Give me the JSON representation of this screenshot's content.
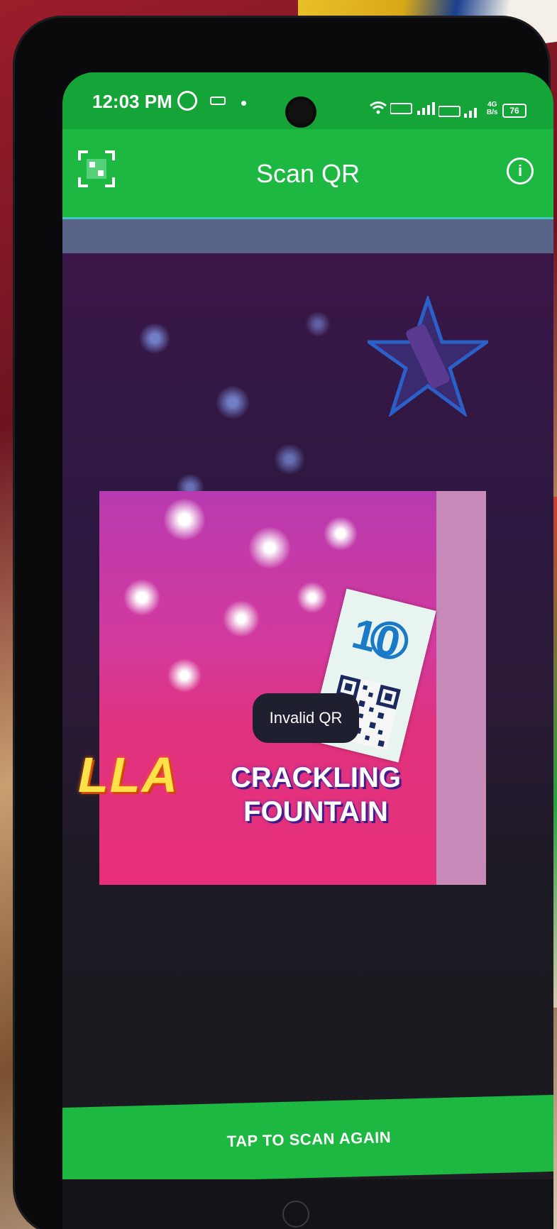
{
  "status_bar": {
    "time": "12:03 PM",
    "speed_top": "4G",
    "speed_bottom": "B/s",
    "battery": "76"
  },
  "app_bar": {
    "title": "Scan QR",
    "info_symbol": "i"
  },
  "camera": {
    "product_brand_text": "LLA",
    "product_line1": "CRACKLING",
    "product_line2": "FOUNTAIN"
  },
  "toast": {
    "message": "Invalid QR"
  },
  "actions": {
    "scan_again_label": "TAP TO SCAN AGAIN"
  },
  "colors": {
    "status_green": "#15a438",
    "app_bar_green": "#1cb841",
    "toast_bg": "#1e2030"
  },
  "icons": [
    "whatsapp-icon",
    "sms-icon",
    "wifi-icon",
    "signal-icon",
    "battery-icon",
    "qr-scan-icon",
    "info-icon",
    "home-icon"
  ]
}
